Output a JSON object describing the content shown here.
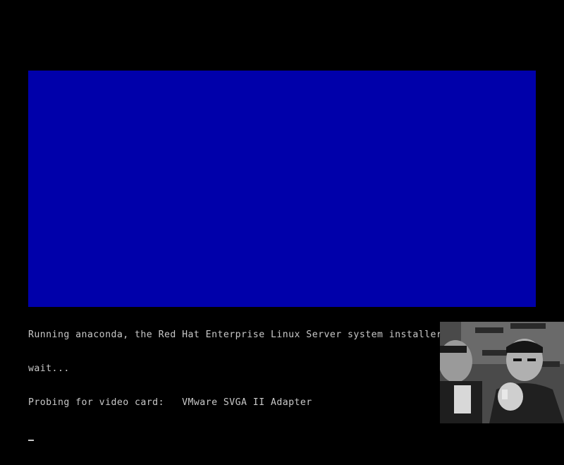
{
  "screen": {
    "background_color": "#000000",
    "panel_color": "#0000aa",
    "text_color": "#c8c8c8"
  },
  "console": {
    "line1": "Running anaconda, the Red Hat Enterprise Linux Server system installer - please",
    "line2": "wait...",
    "line3": "Probing for video card:   VMware SVGA II Adapter",
    "cursor": "_"
  },
  "webcam_overlay": {
    "icon": "webcam-video-overlay",
    "description_visible": false
  }
}
